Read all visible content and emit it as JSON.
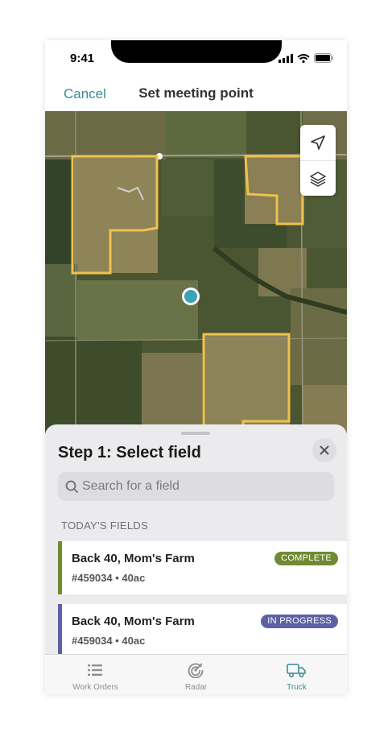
{
  "status_bar": {
    "time": "9:41"
  },
  "nav": {
    "cancel_label": "Cancel",
    "title": "Set meeting point"
  },
  "map": {
    "controls": [
      "location-arrow-icon",
      "layers-icon"
    ],
    "field_outline_color": "#f0c24b",
    "pin_color": "#3aa3b4"
  },
  "sheet": {
    "title": "Step 1: Select field",
    "search_placeholder": "Search for a field",
    "section_label": "TODAY'S FIELDS",
    "fields": [
      {
        "name": "Back 40, Mom's Farm",
        "meta": "#459034 • 40ac",
        "status": "COMPLETE",
        "color": "#6f8a33"
      },
      {
        "name": "Back 40, Mom's Farm",
        "meta": "#459034 • 40ac",
        "status": "IN PROGRESS",
        "color": "#5e5fa4"
      }
    ]
  },
  "tabbar": {
    "tabs": [
      {
        "label": "Work Orders",
        "icon": "list-icon"
      },
      {
        "label": "Radar",
        "icon": "radar-icon"
      },
      {
        "label": "Truck",
        "icon": "truck-icon",
        "active": true
      }
    ],
    "active_color": "#3a8d94"
  }
}
